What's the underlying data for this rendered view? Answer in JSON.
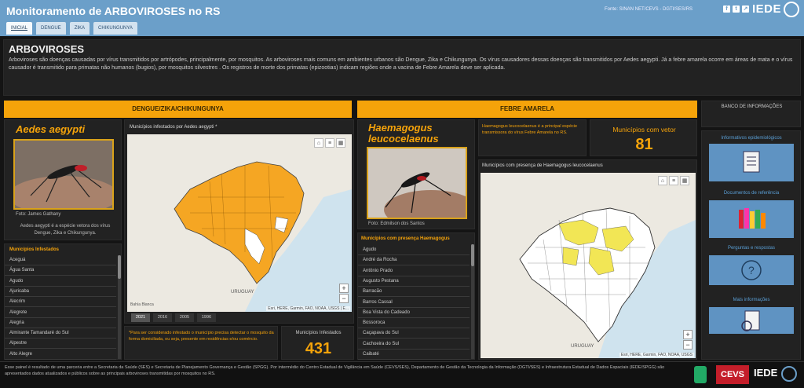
{
  "header": {
    "title": "Monitoramento de ARBOVIROSES no RS",
    "fonte": "Fonte: SINAN NET/CEVS - DGTI/SES/RS",
    "logo_text": "IEDE",
    "tabs": [
      "INICIAL",
      "DENGUE",
      "ZIKA",
      "CHIKUNGUNYA"
    ],
    "active_tab": "INICIAL"
  },
  "intro": {
    "heading": "ARBOVIROSES",
    "text": "Arboviroses são doenças causadas por vírus transmitidos por artrópodes, principalmente, por mosquitos. As arboviroses mais comuns em ambientes urbanos são Dengue, Zika e Chikungunya. Os vírus causadores dessas doenças são transmitidos por Aedes aegypti. Já a febre amarela ocorre em áreas de mata e o vírus causador é transmitido para primatas não humanos (bugios), por mosquitos silvestres . Os registros de morte dos primatas (epizootias) indicam regiões onde a vacina de Febre Amarela deve ser aplicada."
  },
  "dengue": {
    "band": "DENGUE/ZIKA/CHIKUNGUNYA",
    "species": "Aedes aegypti",
    "photo_credit": "Foto: James Gathany",
    "description": "Aedes aegypti é a espécie vetora dos vírus Dengue, Zika e Chikungunya.",
    "list_title": "Municípios Infestados",
    "list": [
      "Aceguá",
      "Água Santa",
      "Agudo",
      "Ajuricaba",
      "Alecrim",
      "Alegrete",
      "Alegria",
      "Almirante Tamandaré do Sul",
      "Alpestre",
      "Alto Alegre"
    ],
    "map_title": "Municípios infestados por Aedes aegypti *",
    "map_attrib": "Esri, HERE, Garmin, FAO, NOAA, USGS | E...",
    "map_labels": [
      "URUGUAY",
      "Bahía Blanca"
    ],
    "years": [
      "2021",
      "2016",
      "2005",
      "1996"
    ],
    "active_year": "2021",
    "note": "*Para ser considerado infestado o município precisa detectar o mosquito da forma domiciliada, ou seja, presente em residências e/ou comércio.",
    "count_label": "Municípios Infestados",
    "count": "431"
  },
  "febre": {
    "band": "FEBRE AMARELA",
    "species": "Haemagogus leucocelaenus",
    "photo_credit": "Foto: Edmilson dos Santos",
    "description": "Haemagogus leucocelaenus é a principal espécie transmissora do vírus Febre Amarela no RS.",
    "count_label": "Municípios com vetor",
    "count": "81",
    "list_title": "Municípios com presença Haemagogus",
    "list": [
      "Agudo",
      "André da Rocha",
      "Antônio Prado",
      "Augusto Pestana",
      "Barracão",
      "Barros Cassal",
      "Boa Vista do Cadeado",
      "Bossoroca",
      "Caçapava do Sul",
      "Cachoeira do Sul",
      "Caibaté"
    ],
    "map_title": "Municípios com presença de Haemagogus leucocelaenus",
    "map_attrib": "Esri, HERE, Garmin, FAO, NOAA, USGS",
    "map_labels": [
      "URUGUAY"
    ]
  },
  "sidebar": {
    "title": "BANCO DE INFORMAÇÕES",
    "items": [
      "Informativos epidemiológicos",
      "Documentos de referência",
      "Perguntas e respostas",
      "Mais informações"
    ]
  },
  "footer": {
    "text": "Esse painel é resultado de uma parceria entre a Secretaria da Saúde (SES) e Secretaria de Planejamento Governança e Gestão (SPGG). Por intermédio do Centro Estadual de Vigilância em Saúde (CEVS/SES), Departamento de Gestão da Tecnologia da Informação (DGTI/SES) e Infraestrutura Estadual de Dados Espaciais (IEDE/SPGG) são apresentados dados atualizados e públicos sobre as principais arboviroses transmitidas por mosquitos no RS.",
    "logos": [
      "CEVS",
      "IEDE"
    ]
  },
  "colors": {
    "accent": "#f5a30a",
    "header": "#6b9fc9",
    "infested": "#f5a623",
    "vector": "#f2e655"
  }
}
